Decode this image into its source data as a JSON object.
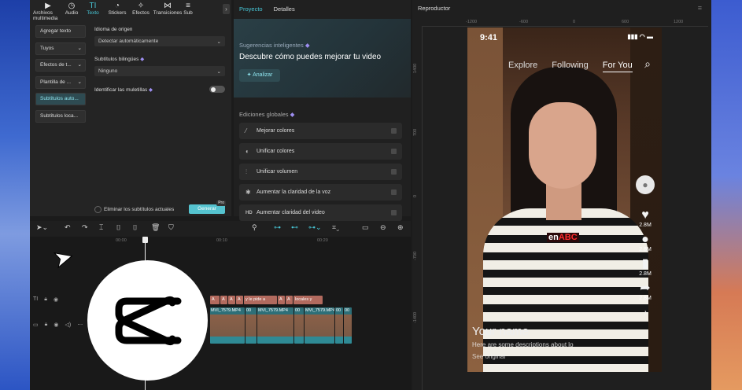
{
  "left_panel": {
    "toolbar": [
      {
        "label": "Archivos multimedia",
        "icon": "media-icon"
      },
      {
        "label": "Audio",
        "icon": "audio-icon"
      },
      {
        "label": "Texto",
        "icon": "text-icon",
        "active": true
      },
      {
        "label": "Stickers",
        "icon": "sticker-icon"
      },
      {
        "label": "Efectos",
        "icon": "effects-icon"
      },
      {
        "label": "Transiciones",
        "icon": "transitions-icon"
      },
      {
        "label": "Sub",
        "icon": "subtitle-icon"
      }
    ],
    "side_items": [
      {
        "label": "Agregar texto"
      },
      {
        "label": "Tuyos",
        "chevron": true
      },
      {
        "label": "Efectos de t...",
        "chevron": true
      },
      {
        "label": "Plantilla de ...",
        "chevron": true
      },
      {
        "label": "Subtítulos auto...",
        "selected": true
      },
      {
        "label": "Subtítulos loca..."
      }
    ],
    "source_language_label": "Idioma de origen",
    "source_language_value": "Detectar automáticamente",
    "bilingual_label": "Subtítulos bilingües",
    "bilingual_value": "Ninguno",
    "filler_label": "Identificar las muletillas",
    "remove_label": "Eliminar los subtítulos actuales",
    "generate_label": "Generar",
    "pro_badge": "Pro"
  },
  "mid_panel": {
    "tab_project": "Proyecto",
    "tab_details": "Detalles",
    "suggestions_label": "Sugerencias inteligentes",
    "suggestions_title": "Descubre cómo puedes mejorar tu video",
    "analyze_label": "Analizar",
    "global_label": "Ediciones globales",
    "global_items": [
      {
        "label": "Mejorar colores",
        "icon": "magic-wand-icon"
      },
      {
        "label": "Unificar colores",
        "icon": "color-icon"
      },
      {
        "label": "Unificar volumen",
        "icon": "volume-icon"
      },
      {
        "label": "Aumentar la claridad de la voz",
        "icon": "voice-icon"
      },
      {
        "label": "Aumentar claridad del video",
        "icon": "hd-icon"
      }
    ]
  },
  "player": {
    "title": "Reproductor",
    "ruler_h": [
      "-1200",
      "-600",
      "0",
      "600",
      "1200"
    ],
    "ruler_v": [
      "1400",
      "700",
      "0",
      "-700",
      "-1400"
    ],
    "phone": {
      "time": "9:41",
      "tabs": [
        "Explore",
        "Following",
        "For You"
      ],
      "active_tab": "For You",
      "logo_en": "en",
      "logo_abc": "ABC",
      "actions": [
        "2.8M",
        "2.8M",
        "2.8M",
        "2.8M"
      ],
      "caption_name": "Your name",
      "caption_desc": "Here are some descriptions about lo",
      "caption_see": "See original"
    }
  },
  "timeline": {
    "ruler": [
      "00:00",
      "00:10",
      "00:20"
    ],
    "text_clips": [
      "A",
      "A",
      "A",
      "A",
      "y le pide a",
      "A",
      "A",
      "locales y"
    ],
    "video_clips": [
      "MVI_7579.MP4",
      "00",
      "MVI_7579.MP4",
      "00",
      "MVI_7579.MP4",
      "00",
      "00"
    ]
  }
}
